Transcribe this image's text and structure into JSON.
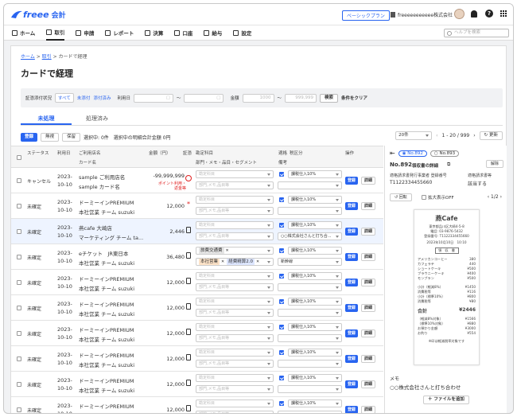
{
  "app": {
    "logo": "freee",
    "logo_suffix": "会計",
    "plan_badge": "ベーシックプラン",
    "company": "freeeeeeeeeee株式会社",
    "search_placeholder": "ヘルプを検索"
  },
  "nav": [
    {
      "label": "ホーム",
      "icon": "home-icon"
    },
    {
      "label": "取引",
      "icon": "ledger-icon",
      "active": true
    },
    {
      "label": "申請",
      "icon": "person-icon"
    },
    {
      "label": "レポート",
      "icon": "report-icon"
    },
    {
      "label": "決算",
      "icon": "book-icon"
    },
    {
      "label": "口座",
      "icon": "card-icon"
    },
    {
      "label": "給与",
      "icon": "payroll-icon"
    },
    {
      "label": "設定",
      "icon": "gear-icon"
    }
  ],
  "breadcrumb": {
    "home": "ホーム",
    "deals": "取引",
    "current": "カードで経理"
  },
  "page_title": "カードで経理",
  "filter": {
    "label_receipt": "証憑添付状況",
    "opt_all": "すべて",
    "opt_unattached": "未添付",
    "opt_attached": "添付済み",
    "label_date": "利用日",
    "tilde1": "〜",
    "label_amount": "金額",
    "amount_from": "1000",
    "tilde2": "〜",
    "amount_to": "999,999",
    "search_btn": "検索",
    "clear_btn": "条件をクリア"
  },
  "tabs": [
    {
      "label": "未処理",
      "active": true
    },
    {
      "label": "処理済み"
    }
  ],
  "actions": {
    "register": "登録",
    "ignore": "無視",
    "hold": "保留",
    "selected_text": "選択中: 0件　選択中の明細合計金額 0円",
    "per_page": "20件",
    "range": "1 - 20 / 999",
    "refresh": "更新"
  },
  "table_header": {
    "status": "ステータス",
    "date": "利用日",
    "shop": "ご利用店名",
    "card": "カード名",
    "amount": "金額（円）",
    "receipt": "証憑",
    "account": "勘定科目",
    "account_sub": "部門・メモ・品目・セグメント",
    "tax": "適格",
    "tax_sub": "備考",
    "taxcat": "税区分",
    "ops": "操作"
  },
  "rows": [
    {
      "status": "キャンセル",
      "date1": "2023-",
      "date2": "10-10",
      "shop": "sample ご利用店名",
      "card": "sample カード名",
      "amount": "-99,999,999",
      "note": "ポイント利用・返金等",
      "receipt": "prohibited-icon",
      "account": "勘定科目",
      "sub": "部門,メモ,品目等",
      "tax_checked": true,
      "taxcat": "課税仕入10%",
      "remark": "",
      "reg": "登録",
      "detail": "詳細"
    },
    {
      "status": "未確定",
      "date1": "2023-",
      "date2": "10-10",
      "shop": "ドーミーインPREMIUM",
      "card": "本社営業 チーム suzuki",
      "amount": "12,000",
      "receipt": "asterisk",
      "account": "勘定科目",
      "sub": "部門,メモ,品目等",
      "tax_checked": true,
      "taxcat": "課税仕入10%",
      "remark": "",
      "reg": "登録",
      "detail": "詳細"
    },
    {
      "status": "未確定",
      "date1": "2023-",
      "date2": "10-10",
      "shop": "燕cafe 大崎店",
      "card": "マーケティング チーム ta...",
      "amount": "2,446",
      "receipt": "document-icon",
      "account": "勘定科目",
      "sub": "部門,メモ,品目等",
      "tax_checked": true,
      "taxcat": "課税仕入10%",
      "remark": "○○株式会社さんと打ち合...",
      "reg": "登録",
      "detail": "詳細",
      "highlight": true
    },
    {
      "status": "未確定",
      "date1": "2023-",
      "date2": "10-10",
      "shop": "eチケット　JR東日本",
      "card": "本社営業 チーム suzuki",
      "amount": "36,480",
      "receipt": "document-icon",
      "account_tag": "旅費交通費",
      "tags": [
        "本社営業",
        "経費精算2.0"
      ],
      "tax_checked": true,
      "taxcat": "課税仕入10%",
      "remark": "新幹線",
      "reg": "登録",
      "detail": "詳細"
    },
    {
      "status": "未確定",
      "date1": "2023-",
      "date2": "10-10",
      "shop": "ドーミーインPREMIUM",
      "card": "本社営業 チーム suzuki",
      "amount": "12,000",
      "receipt": "document-icon",
      "account": "勘定科目",
      "sub": "部門,メモ,品目等",
      "tax_checked": true,
      "taxcat": "課税仕入10%",
      "remark": "",
      "reg": "登録",
      "detail": "詳細"
    },
    {
      "status": "未確定",
      "date1": "2023-",
      "date2": "10-10",
      "shop": "ドーミーインPREMIUM",
      "card": "本社営業 チーム suzuki",
      "amount": "12,000",
      "receipt": "document-icon",
      "account": "勘定科目",
      "sub": "部門,メモ,品目等",
      "tax_checked": true,
      "taxcat": "課税仕入10%",
      "remark": "",
      "reg": "登録",
      "detail": "詳細"
    },
    {
      "status": "未確定",
      "date1": "2023-",
      "date2": "10-10",
      "shop": "ドーミーインPREMIUM",
      "card": "本社営業 チーム suzuki",
      "amount": "12,000",
      "receipt": "document-icon",
      "account": "勘定科目",
      "sub": "部門,メモ,品目等",
      "tax_checked": true,
      "taxcat": "課税仕入10%",
      "remark": "",
      "reg": "登録",
      "detail": "詳細"
    },
    {
      "status": "未確定",
      "date1": "2023-",
      "date2": "10-10",
      "shop": "ドーミーインPREMIUM",
      "card": "本社営業 チーム suzuki",
      "amount": "12,000",
      "receipt": "document-icon",
      "account": "勘定科目",
      "sub": "部門,メモ,品目等",
      "tax_checked": true,
      "taxcat": "課税仕入10%",
      "remark": "",
      "reg": "登録",
      "detail": "詳細"
    },
    {
      "status": "未確定",
      "date1": "2023-",
      "date2": "10-10",
      "shop": "ドーミーインPREMIUM",
      "card": "本社営業 チーム suzuki",
      "amount": "12,000",
      "receipt": "document-icon",
      "account": "勘定科目",
      "sub": "部門,メモ,品目等",
      "tax_checked": true,
      "taxcat": "課税仕入10%",
      "remark": "",
      "reg": "登録",
      "detail": "詳細"
    },
    {
      "status": "未確定",
      "date1": "2023-",
      "date2": "10-10",
      "shop": "ドーミーインPREMIUM",
      "card": "本社営業 チーム suzuki",
      "amount": "12,000",
      "receipt": "document-icon",
      "account": "勘定科目",
      "sub": "部門,メモ,品目等",
      "tax_checked": true,
      "taxcat": "課税仕入10%",
      "remark": "",
      "reg": "登録",
      "detail": "詳細"
    }
  ],
  "panel": {
    "radio1": "No.892",
    "radio2": "No.893",
    "number": "No.892",
    "receipt_detail": "領収書の詳細",
    "unlink": "解除",
    "invoice_label": "適格請求書発行事業者 登録番号",
    "invoice_no": "T1122334455660",
    "invoice_type_label": "適格請求書等",
    "invoice_type": "該当する",
    "rotate": "回転",
    "zoom": "拡大表示OFF",
    "page": "1/2",
    "memo_label": "メモ",
    "memo": "○○株式会社さんと打ち合わせ",
    "add_file": "ファイルを追加"
  },
  "receipt": {
    "shop": "燕Cafe",
    "addr1": "東京都品川区大崎4-5-8",
    "addr2": "電話: 03-9876-5432",
    "addr3": "登録番号: T1122334455660",
    "addr4": "2023年10月10日　10:10",
    "stamp": "領　収　書",
    "items": [
      [
        "アメリカンコーヒー",
        "380"
      ],
      [
        "カフェラテ",
        "440"
      ],
      [
        "ショートケーキ",
        "¥500"
      ],
      [
        "ブラウニーケーキ",
        "¥400"
      ],
      [
        "モンブラン",
        "¥500"
      ]
    ],
    "subs": [
      [
        "小計（軽減8%）",
        "¥1450"
      ],
      [
        "消費税等",
        "¥116"
      ],
      [
        "小計（標準10%）",
        "¥800"
      ],
      [
        "消費税等",
        "¥80"
      ]
    ],
    "total_label": "合計",
    "total": "¥2446",
    "foot": [
      [
        "（軽減8%対象）",
        "¥1566"
      ],
      [
        "（標準10%対象）",
        "¥880"
      ],
      [
        "お預かり金額",
        "¥3000"
      ],
      [
        "お釣り",
        "¥554"
      ]
    ],
    "note": "※印は軽減税率対象です"
  }
}
